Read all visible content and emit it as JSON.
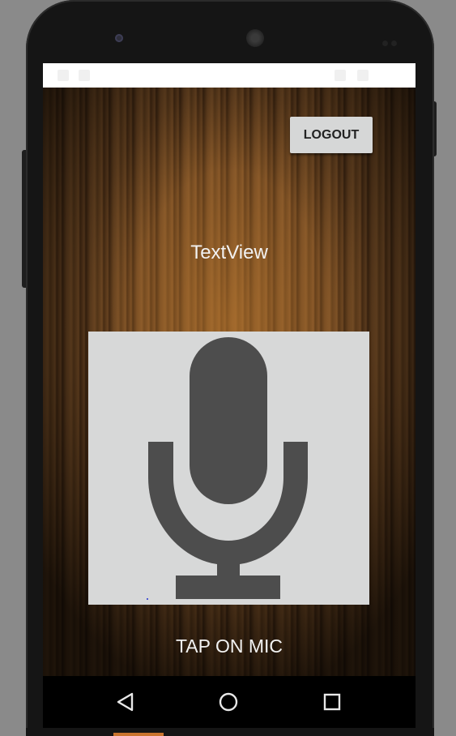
{
  "header": {
    "logout_label": "LOGOUT"
  },
  "main": {
    "textview_label": "TextView",
    "mic_icon": "microphone-icon",
    "tap_label": "TAP ON MIC"
  },
  "navigation": {
    "back_icon": "back-triangle-icon",
    "home_icon": "home-circle-icon",
    "recents_icon": "recents-square-icon"
  },
  "colors": {
    "status_bar": "#ffffff",
    "button_bg": "#d6d7d7",
    "mic_box_bg": "#d7d8d8",
    "mic_color": "#4d4d4d",
    "nav_bar": "#000000",
    "wood_base": "#6a4421"
  }
}
